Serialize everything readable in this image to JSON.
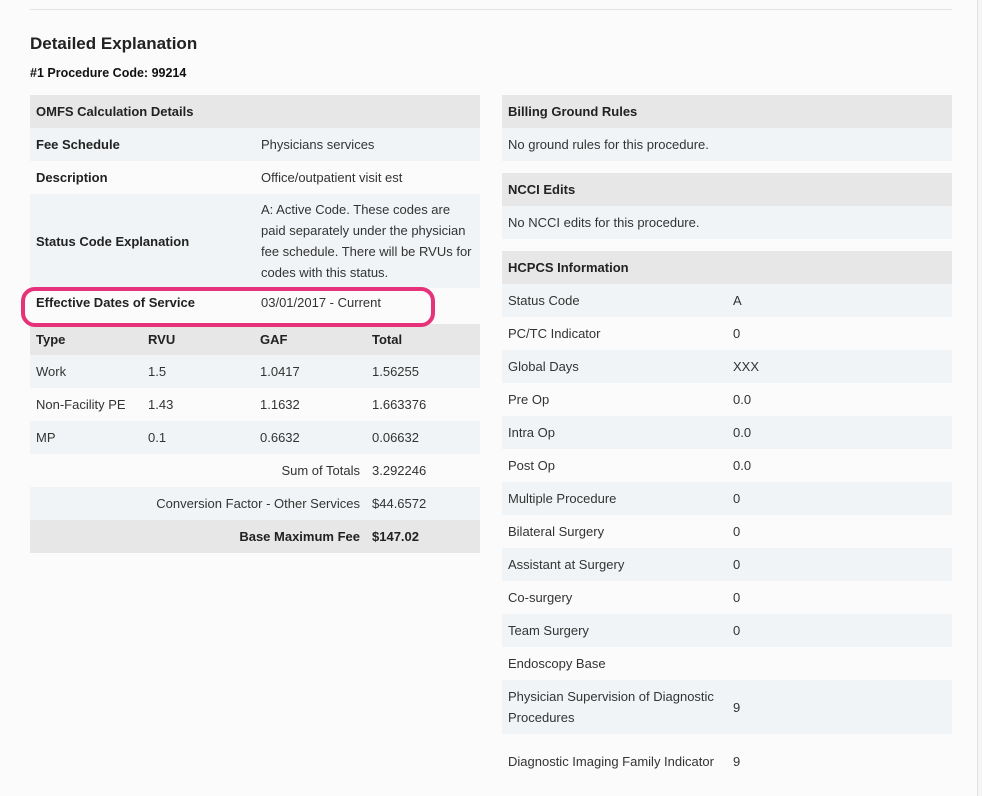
{
  "page": {
    "heading": "Detailed Explanation",
    "procedure_line": "#1 Procedure Code: 99214"
  },
  "omfs": {
    "header": "OMFS Calculation Details",
    "rows": [
      {
        "label": "Fee Schedule",
        "value": "Physicians services"
      },
      {
        "label": "Description",
        "value": "Office/outpatient visit est"
      },
      {
        "label": "Status Code Explanation",
        "value": "A: Active Code. These codes are paid separately under the physician fee schedule. There will be RVUs for codes with this status."
      },
      {
        "label": "Effective Dates of Service",
        "value": "03/01/2017 - Current"
      }
    ]
  },
  "rvu_table": {
    "columns": [
      "Type",
      "RVU",
      "GAF",
      "Total"
    ],
    "rows": [
      [
        "Work",
        "1.5",
        "1.0417",
        "1.56255"
      ],
      [
        "Non-Facility PE",
        "1.43",
        "1.1632",
        "1.663376"
      ],
      [
        "MP",
        "0.1",
        "0.6632",
        "0.06632"
      ]
    ],
    "sum_label": "Sum of Totals",
    "sum_value": "3.292246",
    "cf_label": "Conversion Factor - Other Services",
    "cf_value": "$44.6572",
    "base_label": "Base Maximum Fee",
    "base_value": "$147.02"
  },
  "billing": {
    "header": "Billing Ground Rules",
    "text": "No ground rules for this procedure."
  },
  "ncci": {
    "header": "NCCI Edits",
    "text": "No NCCI edits for this procedure."
  },
  "hcpcs": {
    "header": "HCPCS Information",
    "rows": [
      {
        "label": "Status Code",
        "value": "A"
      },
      {
        "label": "PC/TC Indicator",
        "value": "0"
      },
      {
        "label": "Global Days",
        "value": "XXX"
      },
      {
        "label": "Pre Op",
        "value": "0.0"
      },
      {
        "label": "Intra Op",
        "value": "0.0"
      },
      {
        "label": "Post Op",
        "value": "0.0"
      },
      {
        "label": "Multiple Procedure",
        "value": "0"
      },
      {
        "label": "Bilateral Surgery",
        "value": "0"
      },
      {
        "label": "Assistant at Surgery",
        "value": "0"
      },
      {
        "label": "Co-surgery",
        "value": "0"
      },
      {
        "label": "Team Surgery",
        "value": "0"
      },
      {
        "label": "Endoscopy Base",
        "value": ""
      },
      {
        "label": "Physician Supervision of Diagnostic Procedures",
        "value": "9"
      },
      {
        "label": "Diagnostic Imaging Family Indicator",
        "value": "9"
      }
    ]
  },
  "colors": {
    "highlight": "#e5327a",
    "header_bg": "#e7e7e7",
    "stripe_bg": "#f1f4f6"
  }
}
